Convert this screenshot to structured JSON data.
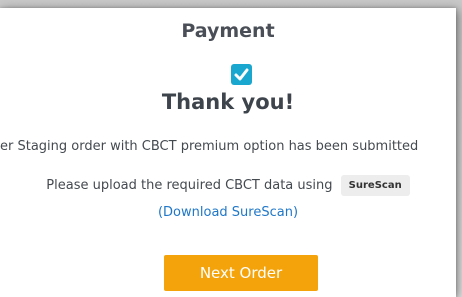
{
  "page_title": "Payment",
  "confirmation": {
    "checked": true,
    "heading": "Thank you!",
    "submitted_text": "er Staging order with CBCT premium option has been submitted"
  },
  "upload": {
    "instruction": "Please upload the required CBCT data using",
    "app_badge": "SureScan",
    "download_link": "(Download SureScan)"
  },
  "actions": {
    "next_order_label": "Next Order"
  },
  "colors": {
    "accent_blue": "#1aa7cf",
    "button_orange": "#f5a30a",
    "link_blue": "#1f77c8"
  },
  "icons": {
    "check": "checkbox-checked-icon"
  }
}
